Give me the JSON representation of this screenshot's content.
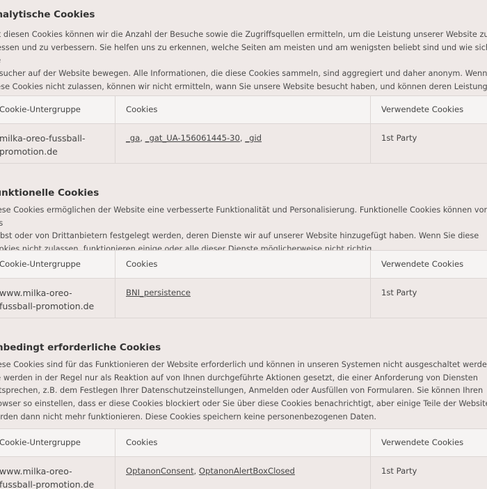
{
  "sections": [
    {
      "title": "Analytische Cookies",
      "description": "Mit diesen Cookies können wir die Anzahl der Besuche sowie die Zugriffsquellen ermitteln, um die Leistung unserer Website zu\nmessen und zu verbessern. Sie helfen uns zu erkennen, welche Seiten am meisten und am wenigsten beliebt sind und wie sich die\nBesucher auf der Website bewegen. Alle Informationen, die diese Cookies sammeln, sind aggregiert und daher anonym. Wenn Sie\ndiese Cookies nicht zulassen, können wir nicht ermitteln, wann Sie unsere Website besucht haben, und können deren Leistung\nnicht überwachen.",
      "table": {
        "headers": [
          "Cookie-Untergruppe",
          "Cookies",
          "Verwendete Cookies"
        ],
        "subgroup": "milka-oreo-fussball-\npromotion.de",
        "cookies": [
          "_ga",
          "_gat_UA-156061445-30",
          "_gid"
        ],
        "usage": "1st Party"
      }
    },
    {
      "title": "Funktionelle Cookies",
      "description": "Diese Cookies ermöglichen der Website eine verbesserte Funktionalität und Personalisierung. Funktionelle Cookies können von uns\nselbst oder von Drittanbietern festgelegt werden, deren Dienste wir auf unserer Website hinzugefügt haben. Wenn Sie diese\nCookies nicht zulassen, funktionieren einige oder alle dieser Dienste möglicherweise nicht richtig.",
      "table": {
        "headers": [
          "Cookie-Untergruppe",
          "Cookies",
          "Verwendete Cookies"
        ],
        "subgroup": "www.milka-oreo-\nfussball-promotion.de",
        "cookies": [
          "BNI_persistence"
        ],
        "usage": "1st Party"
      }
    },
    {
      "title": "Unbedingt erforderliche Cookies",
      "description": "Diese Cookies sind für das Funktionieren der Website erforderlich und können in unseren Systemen nicht ausgeschaltet werden.\nSie werden in der Regel nur als Reaktion auf von Ihnen durchgeführte Aktionen gesetzt, die einer Anforderung von Diensten\nentsprechen, z.B. dem Festlegen Ihrer Datenschutzeinstellungen, Anmelden oder Ausfüllen von Formularen. Sie können Ihren\nBrowser so einstellen, dass er diese Cookies blockiert oder Sie über diese Cookies benachrichtigt, aber einige Teile der Website\nwerden dann nicht mehr funktionieren. Diese Cookies speichern keine personenbezogenen Daten.",
      "table": {
        "headers": [
          "Cookie-Untergruppe",
          "Cookies",
          "Verwendete Cookies"
        ],
        "subgroup": "www.milka-oreo-\nfussball-promotion.de",
        "cookies": [
          "OptanonConsent",
          "OptanonAlertBoxClosed"
        ],
        "usage": "1st Party"
      }
    }
  ]
}
